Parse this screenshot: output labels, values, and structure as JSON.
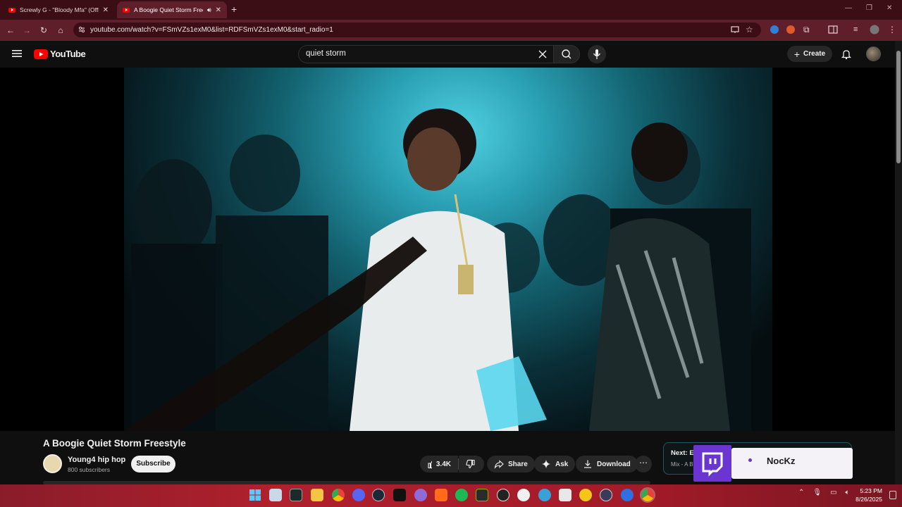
{
  "browser": {
    "tabs": [
      {
        "title": "Screwly G - \"Bloody Mfa\" (Offic",
        "active": false
      },
      {
        "title": "A Boogie Quiet Storm Free",
        "active": true
      }
    ],
    "url": "youtube.com/watch?v=FSmVZs1exM0&list=RDFSmVZs1exM0&start_radio=1",
    "accent": "#5e1f2a"
  },
  "youtube": {
    "logo_text": "YouTube",
    "search_value": "quiet storm",
    "create_label": "Create"
  },
  "video": {
    "title": "A Boogie Quiet Storm Freestyle",
    "channel": "Young4 hip hop",
    "subscribers": "800 subscribers",
    "subscribe_label": "Subscribe",
    "likes": "3.4K",
    "share_label": "Share",
    "ask_label": "Ask",
    "download_label": "Download"
  },
  "next_up": {
    "label": "Next: El",
    "sub": "Mix - A B"
  },
  "twitch_notification": {
    "name": "NocKz"
  },
  "taskbar": {
    "time": "5:23 PM",
    "date": "8/26/2025"
  }
}
